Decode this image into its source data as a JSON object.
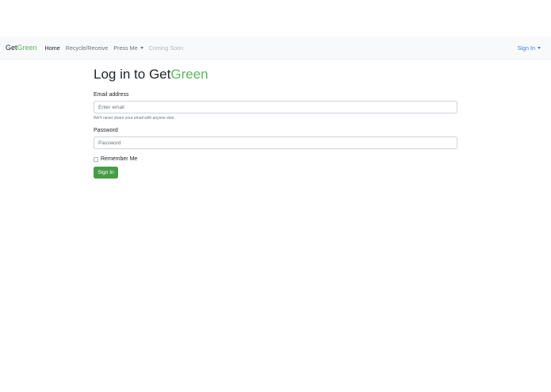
{
  "brand": {
    "part1": "Get",
    "part2": "Green"
  },
  "nav": {
    "home": "Home",
    "recycle": "Recycle/Receive",
    "press": "Press Me",
    "coming": "Coming Soon",
    "signin": "Sign In"
  },
  "login": {
    "title_prefix": "Log in to Get",
    "title_suffix": "Green",
    "email_label": "Email address",
    "email_placeholder": "Enter email",
    "email_help": "We'll never share your email with anyone else.",
    "password_label": "Password",
    "password_placeholder": "Password",
    "remember_label": "Remember Me",
    "submit_label": "Sign In"
  },
  "colors": {
    "accent_green": "#5cb85c",
    "button_green": "#469d46",
    "link_blue": "#3a84d8",
    "navbar_bg": "#f8f9fa"
  },
  "icons": {
    "dropdown": "caret-down-icon"
  }
}
